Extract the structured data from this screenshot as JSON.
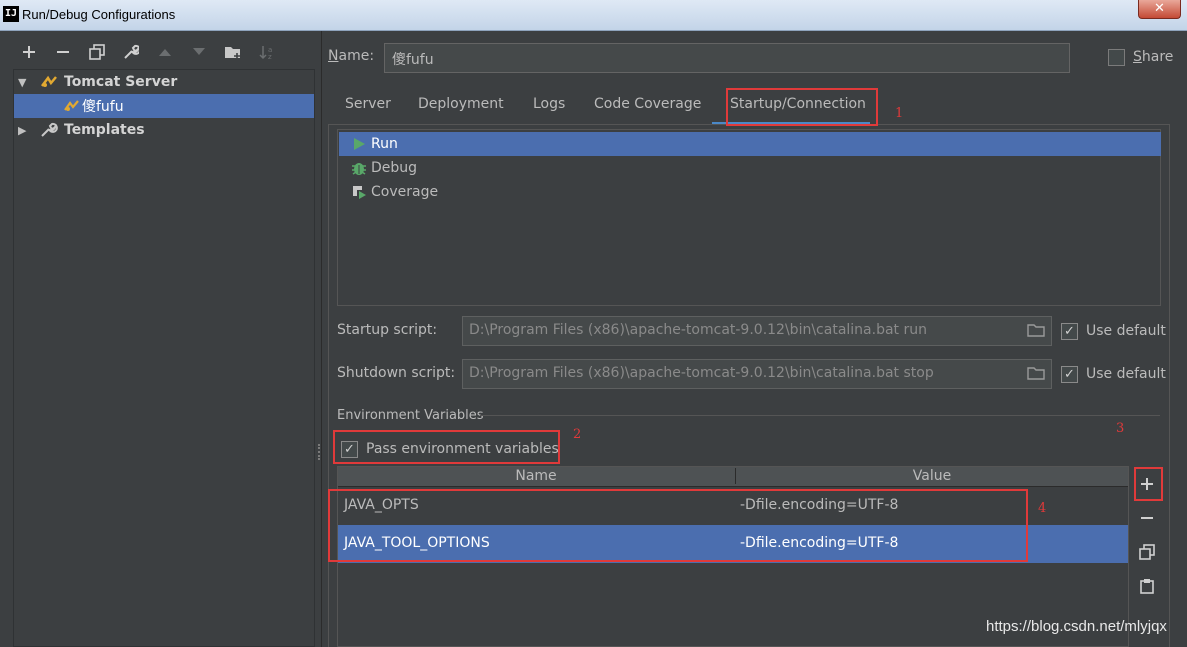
{
  "window": {
    "title": "Run/Debug Configurations",
    "app_icon": "IJ",
    "close_label": "✕"
  },
  "toolbar": {
    "add": "+",
    "remove": "−",
    "copy": "copy-icon",
    "edit": "wrench-icon",
    "up": "▲",
    "down": "▼",
    "folder": "folder-add-icon",
    "sort": "sort-icon"
  },
  "tree": {
    "items": [
      {
        "label": "Tomcat Server",
        "expanded": true
      },
      {
        "label": "傻fufu",
        "selected": true
      },
      {
        "label": "Templates",
        "expanded": false
      }
    ]
  },
  "name": {
    "label_prefix": "",
    "label_mnemonic": "N",
    "label_rest": "ame:",
    "value": "傻fufu"
  },
  "share": {
    "mnemonic": "S",
    "rest": "hare",
    "checked": false
  },
  "tabs": [
    "Server",
    "Deployment",
    "Logs",
    "Code Coverage",
    "Startup/Connection"
  ],
  "active_tab": "Startup/Connection",
  "modes": [
    {
      "label": "Run",
      "icon": "run-icon",
      "selected": true
    },
    {
      "label": "Debug",
      "icon": "debug-bug-icon",
      "selected": false
    },
    {
      "label": "Coverage",
      "icon": "coverage-icon",
      "selected": false
    }
  ],
  "startup": {
    "label": "Startup script:",
    "value": "D:\\Program Files (x86)\\apache-tomcat-9.0.12\\bin\\catalina.bat run",
    "use_default": "Use default"
  },
  "shutdown": {
    "label": "Shutdown script:",
    "value": "D:\\Program Files (x86)\\apache-tomcat-9.0.12\\bin\\catalina.bat stop",
    "use_default": "Use default"
  },
  "env": {
    "section_title": "Environment Variables",
    "pass_label": "Pass environment variables",
    "columns": [
      "Name",
      "Value"
    ],
    "rows": [
      {
        "name": "JAVA_OPTS",
        "value": "-Dfile.encoding=UTF-8",
        "selected": false
      },
      {
        "name": "JAVA_TOOL_OPTIONS",
        "value": "-Dfile.encoding=UTF-8",
        "selected": true
      }
    ]
  },
  "annotations": [
    "1",
    "2",
    "3",
    "4"
  ],
  "watermark": "https://blog.csdn.net/mlyjqx",
  "colors": {
    "selection": "#4b6eaf",
    "annotation": "#e03a3a",
    "background": "#3c3f41",
    "run": "#59a869"
  }
}
